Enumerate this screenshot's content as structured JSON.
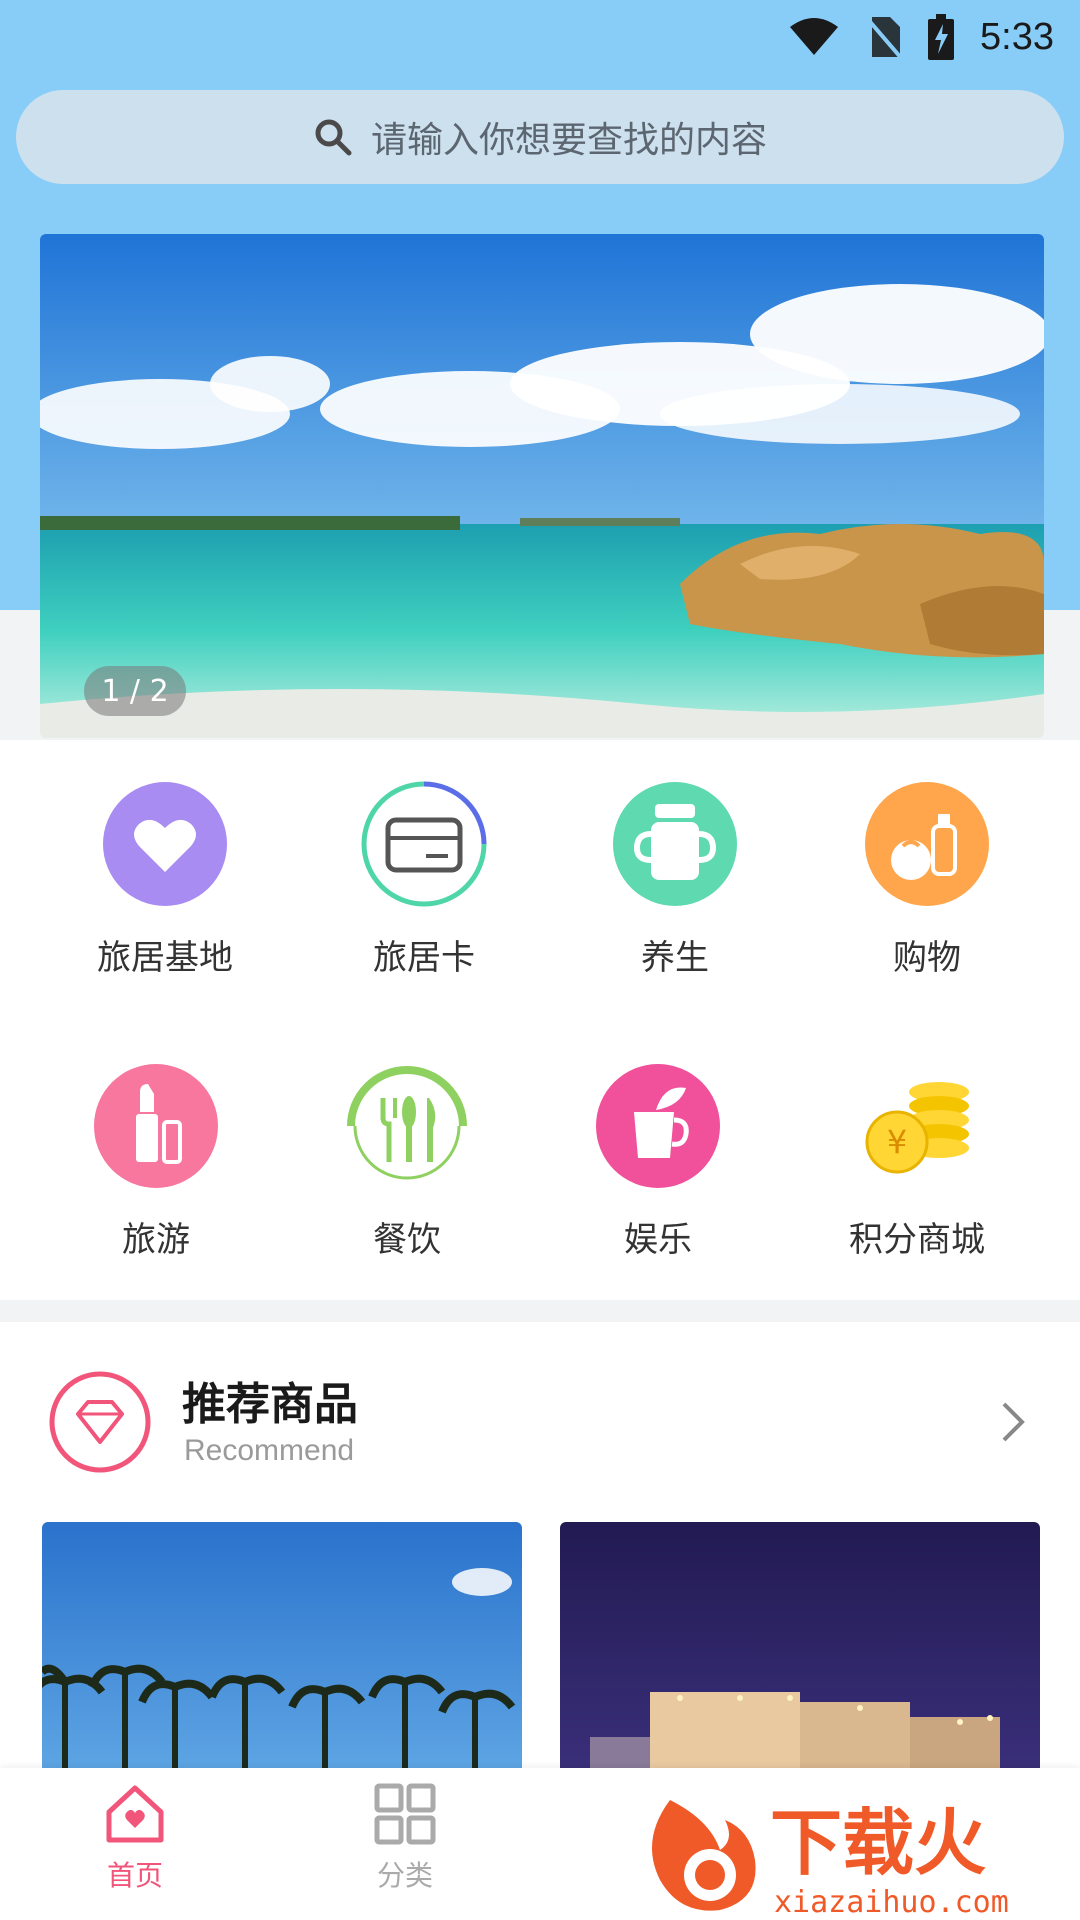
{
  "status_bar": {
    "time": "5:33"
  },
  "search": {
    "placeholder": "请输入你想要查找的内容"
  },
  "banner": {
    "indicator": "1 / 2"
  },
  "categories": [
    {
      "label": "旅居基地",
      "icon": "heart-icon",
      "color": "#a98cf2"
    },
    {
      "label": "旅居卡",
      "icon": "card-icon",
      "color": "#4fd6a8"
    },
    {
      "label": "养生",
      "icon": "cup-icon",
      "color": "#5ed9b0"
    },
    {
      "label": "购物",
      "icon": "shopping-icon",
      "color": "#ffa64d"
    },
    {
      "label": "旅游",
      "icon": "lipstick-icon",
      "color": "#f7779e"
    },
    {
      "label": "餐饮",
      "icon": "cutlery-icon",
      "color": "#8fd160"
    },
    {
      "label": "娱乐",
      "icon": "drink-icon",
      "color": "#f0519a"
    },
    {
      "label": "积分商城",
      "icon": "coins-icon",
      "color": "#ffd633"
    }
  ],
  "recommend": {
    "title": "推荐商品",
    "subtitle": "Recommend",
    "accent": "#f2557a"
  },
  "bottom_nav": [
    {
      "label": "首页",
      "icon": "home-icon",
      "active": true
    },
    {
      "label": "分类",
      "icon": "grid-icon",
      "active": false
    }
  ],
  "watermark": {
    "text": "下载火",
    "url_text": "xiazaihuo.com"
  },
  "colors": {
    "header_bg": "#87cdf8",
    "active": "#f2557a",
    "inactive": "#aaaaaa"
  }
}
